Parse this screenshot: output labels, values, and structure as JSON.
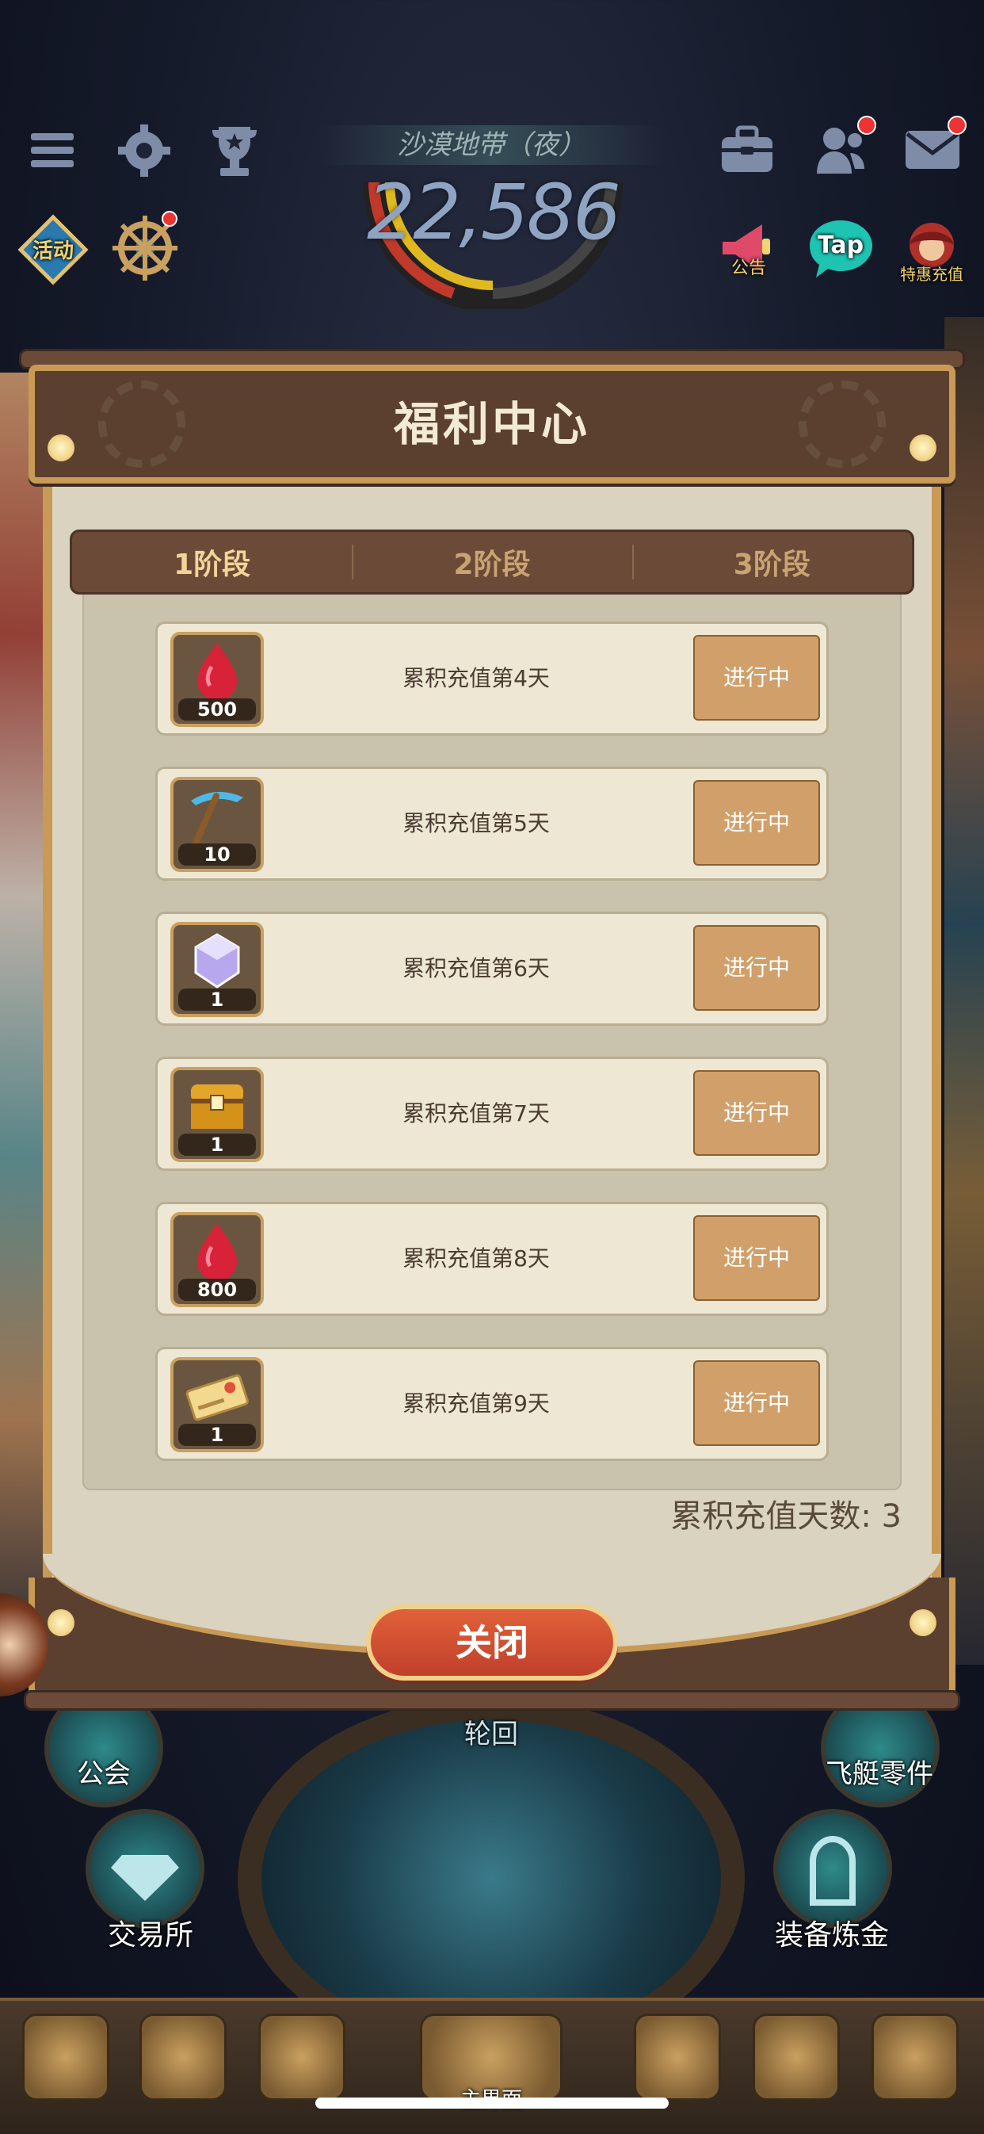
{
  "hud": {
    "zone_name": "沙漠地带（夜）",
    "power_value": "22,586",
    "left_icons": [
      {
        "name": "menu-icon"
      },
      {
        "name": "settings-gear-icon"
      },
      {
        "name": "trophy-icon"
      }
    ],
    "left_row2": [
      {
        "label": "活动",
        "name": "event-icon"
      },
      {
        "label": "",
        "name": "ship-wheel-icon"
      }
    ],
    "right_icons": [
      {
        "name": "toolbox-icon"
      },
      {
        "name": "friends-icon"
      },
      {
        "name": "mail-icon"
      }
    ],
    "right_row2": [
      {
        "label": "公告",
        "name": "announcement-icon"
      },
      {
        "label": "Tap",
        "name": "taptap-icon"
      },
      {
        "label": "特惠充值",
        "name": "special-recharge-icon"
      }
    ]
  },
  "modal": {
    "title": "福利中心",
    "tabs": [
      {
        "label": "1阶段",
        "active": true
      },
      {
        "label": "2阶段",
        "active": false
      },
      {
        "label": "3阶段",
        "active": false
      }
    ],
    "rewards": [
      {
        "icon": "red-gem-icon",
        "qty": "500",
        "text": "累积充值第4天",
        "status": "进行中"
      },
      {
        "icon": "pickaxe-icon",
        "qty": "10",
        "text": "累积充值第5天",
        "status": "进行中"
      },
      {
        "icon": "crystal-icon",
        "qty": "1",
        "text": "累积充值第6天",
        "status": "进行中"
      },
      {
        "icon": "treasure-chest-icon",
        "qty": "1",
        "text": "累积充值第7天",
        "status": "进行中"
      },
      {
        "icon": "red-gem-icon",
        "qty": "800",
        "text": "累积充值第8天",
        "status": "进行中"
      },
      {
        "icon": "ticket-icon",
        "qty": "1",
        "text": "累积充值第9天",
        "status": "进行中"
      }
    ],
    "cumulative_days": "累积充值天数: 3",
    "close_label": "关闭"
  },
  "bottom_labels": {
    "guild": "公会",
    "cycle": "轮回",
    "airship_parts": "飞艇零件",
    "exchange": "交易所",
    "equip_alchemy": "装备炼金",
    "main": "主界面"
  }
}
